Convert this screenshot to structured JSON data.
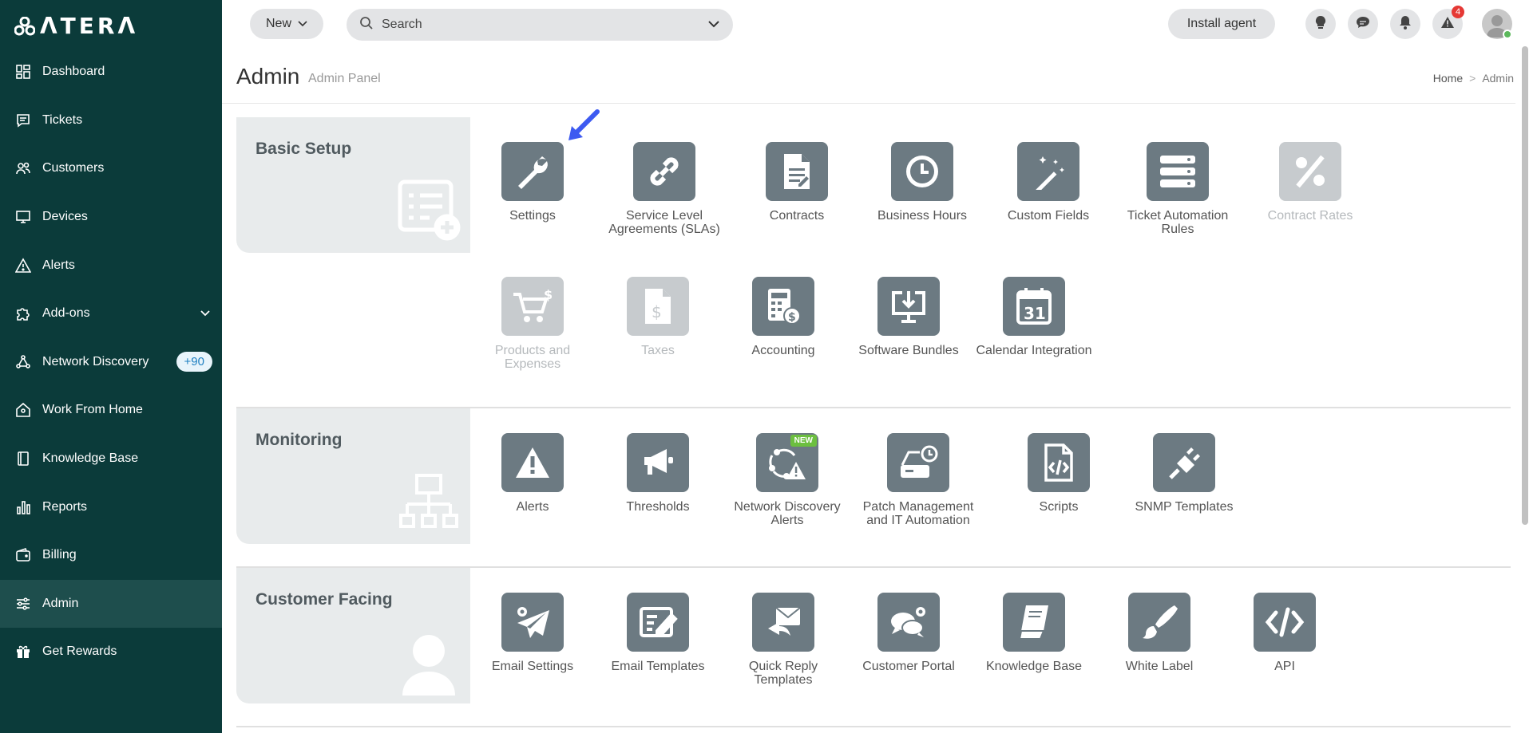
{
  "brand": {
    "logo_text": "ΛTERΛ"
  },
  "sidebar": {
    "items": [
      {
        "label": "Dashboard",
        "icon": "dashboard-icon"
      },
      {
        "label": "Tickets",
        "icon": "ticket-icon"
      },
      {
        "label": "Customers",
        "icon": "customers-icon"
      },
      {
        "label": "Devices",
        "icon": "monitor-icon"
      },
      {
        "label": "Alerts",
        "icon": "alert-icon"
      },
      {
        "label": "Add-ons",
        "icon": "puzzle-icon"
      },
      {
        "label": "Network Discovery",
        "icon": "network-icon",
        "badge": "+90"
      },
      {
        "label": "Work From Home",
        "icon": "home-icon"
      },
      {
        "label": "Knowledge Base",
        "icon": "book-icon"
      },
      {
        "label": "Reports",
        "icon": "bar-chart-icon"
      },
      {
        "label": "Billing",
        "icon": "wallet-icon"
      },
      {
        "label": "Admin",
        "icon": "sliders-icon",
        "active": true
      },
      {
        "label": "Get Rewards",
        "icon": "gift-icon"
      }
    ]
  },
  "topbar": {
    "new_label": "New",
    "search_placeholder": "Search",
    "install_label": "Install agent",
    "alert_count": "4"
  },
  "header": {
    "title": "Admin",
    "subtitle": "Admin Panel",
    "breadcrumb": {
      "home": "Home",
      "sep": ">",
      "current": "Admin"
    }
  },
  "sections": {
    "basic": {
      "title": "Basic Setup",
      "tiles": {
        "settings": "Settings",
        "sla": "Service Level Agreements (SLAs)",
        "contracts": "Contracts",
        "business_hours": "Business Hours",
        "custom_fields": "Custom Fields",
        "ticket_automation": "Ticket Automation Rules",
        "contract_rates": "Contract Rates",
        "products": "Products and Expenses",
        "taxes": "Taxes",
        "accounting": "Accounting",
        "software_bundles": "Software Bundles",
        "calendar": "Calendar Integration"
      }
    },
    "monitoring": {
      "title": "Monitoring",
      "tiles": {
        "alerts": "Alerts",
        "thresholds": "Thresholds",
        "network_alerts": "Network Discovery Alerts",
        "new_tag": "NEW",
        "patch": "Patch Management and IT Automation",
        "scripts": "Scripts",
        "snmp": "SNMP Templates"
      }
    },
    "customer": {
      "title": "Customer Facing",
      "tiles": {
        "email_settings": "Email Settings",
        "email_templates": "Email Templates",
        "quick_reply": "Quick Reply Templates",
        "portal": "Customer Portal",
        "kb": "Knowledge Base",
        "white_label": "White Label",
        "api": "API"
      }
    }
  },
  "calendar_day": "31",
  "colors": {
    "sidebar": "#0b3b3a",
    "tile": "#6c7a82",
    "tile_disabled": "#c7cbce",
    "accent_arrow": "#3d5af1"
  }
}
